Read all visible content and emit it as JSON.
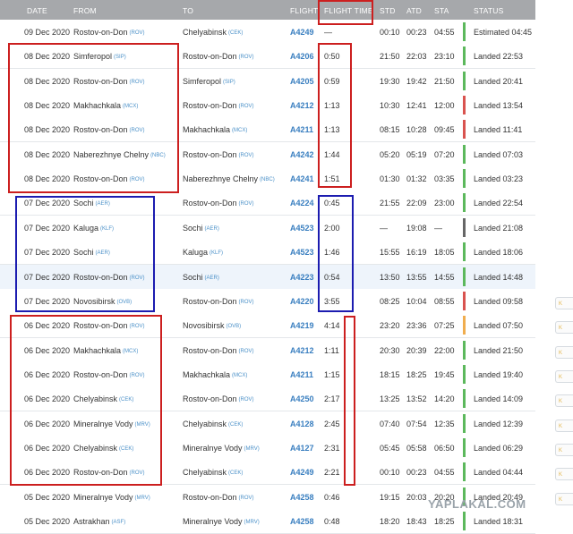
{
  "columns": {
    "date": "DATE",
    "from": "FROM",
    "to": "TO",
    "flight": "FLIGHT",
    "flight_time": "FLIGHT TIME",
    "std": "STD",
    "atd": "ATD",
    "sta": "STA",
    "status": "STATUS"
  },
  "rows": [
    {
      "date": "09 Dec 2020",
      "from": "Rostov-on-Don",
      "from_code": "(ROV)",
      "to": "Chelyabinsk",
      "to_code": "(CEK)",
      "flight": "A4249",
      "flight_time": "—",
      "std": "00:10",
      "atd": "00:23",
      "sta": "04:55",
      "status": "Estimated 04:45",
      "status_color": "#5cb85c"
    },
    {
      "date": "08 Dec 2020",
      "from": "Simferopol",
      "from_code": "(SIP)",
      "to": "Rostov-on-Don",
      "to_code": "(ROV)",
      "flight": "A4206",
      "flight_time": "0:50",
      "std": "21:50",
      "atd": "22:03",
      "sta": "23:10",
      "status": "Landed 22:53",
      "status_color": "#5cb85c"
    },
    {
      "date": "08 Dec 2020",
      "from": "Rostov-on-Don",
      "from_code": "(ROV)",
      "to": "Simferopol",
      "to_code": "(SIP)",
      "flight": "A4205",
      "flight_time": "0:59",
      "std": "19:30",
      "atd": "19:42",
      "sta": "21:50",
      "status": "Landed 20:41",
      "status_color": "#5cb85c"
    },
    {
      "date": "08 Dec 2020",
      "from": "Makhachkala",
      "from_code": "(MCX)",
      "to": "Rostov-on-Don",
      "to_code": "(ROV)",
      "flight": "A4212",
      "flight_time": "1:13",
      "std": "10:30",
      "atd": "12:41",
      "sta": "12:00",
      "status": "Landed 13:54",
      "status_color": "#d9534f"
    },
    {
      "date": "08 Dec 2020",
      "from": "Rostov-on-Don",
      "from_code": "(ROV)",
      "to": "Makhachkala",
      "to_code": "(MCX)",
      "flight": "A4211",
      "flight_time": "1:13",
      "std": "08:15",
      "atd": "10:28",
      "sta": "09:45",
      "status": "Landed 11:41",
      "status_color": "#d9534f"
    },
    {
      "date": "08 Dec 2020",
      "from": "Naberezhnye Chelny",
      "from_code": "(NBC)",
      "to": "Rostov-on-Don",
      "to_code": "(ROV)",
      "flight": "A4242",
      "flight_time": "1:44",
      "std": "05:20",
      "atd": "05:19",
      "sta": "07:20",
      "status": "Landed 07:03",
      "status_color": "#5cb85c"
    },
    {
      "date": "08 Dec 2020",
      "from": "Rostov-on-Don",
      "from_code": "(ROV)",
      "to": "Naberezhnye Chelny",
      "to_code": "(NBC)",
      "flight": "A4241",
      "flight_time": "1:51",
      "std": "01:30",
      "atd": "01:32",
      "sta": "03:35",
      "status": "Landed 03:23",
      "status_color": "#5cb85c"
    },
    {
      "date": "07 Dec 2020",
      "from": "Sochi",
      "from_code": "(AER)",
      "to": "Rostov-on-Don",
      "to_code": "(ROV)",
      "flight": "A4224",
      "flight_time": "0:45",
      "std": "21:55",
      "atd": "22:09",
      "sta": "23:00",
      "status": "Landed 22:54",
      "status_color": "#5cb85c"
    },
    {
      "date": "07 Dec 2020",
      "from": "Kaluga",
      "from_code": "(KLF)",
      "to": "Sochi",
      "to_code": "(AER)",
      "flight": "A4523",
      "flight_time": "2:00",
      "std": "—",
      "atd": "19:08",
      "sta": "—",
      "status": "Landed 21:08",
      "status_color": "#666666"
    },
    {
      "date": "07 Dec 2020",
      "from": "Sochi",
      "from_code": "(AER)",
      "to": "Kaluga",
      "to_code": "(KLF)",
      "flight": "A4523",
      "flight_time": "1:46",
      "std": "15:55",
      "atd": "16:19",
      "sta": "18:05",
      "status": "Landed 18:06",
      "status_color": "#5cb85c"
    },
    {
      "date": "07 Dec 2020",
      "from": "Rostov-on-Don",
      "from_code": "(ROV)",
      "to": "Sochi",
      "to_code": "(AER)",
      "flight": "A4223",
      "flight_time": "0:54",
      "std": "13:50",
      "atd": "13:55",
      "sta": "14:55",
      "status": "Landed 14:48",
      "status_color": "#5cb85c",
      "highlight": true
    },
    {
      "date": "07 Dec 2020",
      "from": "Novosibirsk",
      "from_code": "(OVB)",
      "to": "Rostov-on-Don",
      "to_code": "(ROV)",
      "flight": "A4220",
      "flight_time": "3:55",
      "std": "08:25",
      "atd": "10:04",
      "sta": "08:55",
      "status": "Landed 09:58",
      "status_color": "#d9534f"
    },
    {
      "date": "06 Dec 2020",
      "from": "Rostov-on-Don",
      "from_code": "(ROV)",
      "to": "Novosibirsk",
      "to_code": "(OVB)",
      "flight": "A4219",
      "flight_time": "4:14",
      "std": "23:20",
      "atd": "23:36",
      "sta": "07:25",
      "status": "Landed 07:50",
      "status_color": "#f0ad4e"
    },
    {
      "date": "06 Dec 2020",
      "from": "Makhachkala",
      "from_code": "(MCX)",
      "to": "Rostov-on-Don",
      "to_code": "(ROV)",
      "flight": "A4212",
      "flight_time": "1:11",
      "std": "20:30",
      "atd": "20:39",
      "sta": "22:00",
      "status": "Landed 21:50",
      "status_color": "#5cb85c"
    },
    {
      "date": "06 Dec 2020",
      "from": "Rostov-on-Don",
      "from_code": "(ROV)",
      "to": "Makhachkala",
      "to_code": "(MCX)",
      "flight": "A4211",
      "flight_time": "1:15",
      "std": "18:15",
      "atd": "18:25",
      "sta": "19:45",
      "status": "Landed 19:40",
      "status_color": "#5cb85c"
    },
    {
      "date": "06 Dec 2020",
      "from": "Chelyabinsk",
      "from_code": "(CEK)",
      "to": "Rostov-on-Don",
      "to_code": "(ROV)",
      "flight": "A4250",
      "flight_time": "2:17",
      "std": "13:25",
      "atd": "13:52",
      "sta": "14:20",
      "status": "Landed 14:09",
      "status_color": "#5cb85c"
    },
    {
      "date": "06 Dec 2020",
      "from": "Mineralnye Vody",
      "from_code": "(MRV)",
      "to": "Chelyabinsk",
      "to_code": "(CEK)",
      "flight": "A4128",
      "flight_time": "2:45",
      "std": "07:40",
      "atd": "07:54",
      "sta": "12:35",
      "status": "Landed 12:39",
      "status_color": "#5cb85c"
    },
    {
      "date": "06 Dec 2020",
      "from": "Chelyabinsk",
      "from_code": "(CEK)",
      "to": "Mineralnye Vody",
      "to_code": "(MRV)",
      "flight": "A4127",
      "flight_time": "2:31",
      "std": "05:45",
      "atd": "05:58",
      "sta": "06:50",
      "status": "Landed 06:29",
      "status_color": "#5cb85c"
    },
    {
      "date": "06 Dec 2020",
      "from": "Rostov-on-Don",
      "from_code": "(ROV)",
      "to": "Chelyabinsk",
      "to_code": "(CEK)",
      "flight": "A4249",
      "flight_time": "2:21",
      "std": "00:10",
      "atd": "00:23",
      "sta": "04:55",
      "status": "Landed 04:44",
      "status_color": "#5cb85c"
    },
    {
      "date": "05 Dec 2020",
      "from": "Mineralnye Vody",
      "from_code": "(MRV)",
      "to": "Rostov-on-Don",
      "to_code": "(ROV)",
      "flight": "A4258",
      "flight_time": "0:46",
      "std": "19:15",
      "atd": "20:03",
      "sta": "20:20",
      "status": "Landed 20:49",
      "status_color": "#5cb85c"
    },
    {
      "date": "05 Dec 2020",
      "from": "Astrakhan",
      "from_code": "(ASF)",
      "to": "Mineralnye Vody",
      "to_code": "(MRV)",
      "flight": "A4258",
      "flight_time": "0:48",
      "std": "18:20",
      "atd": "18:43",
      "sta": "18:25",
      "status": "Landed 18:31",
      "status_color": "#5cb85c"
    }
  ],
  "side_tags": [
    "K",
    "K",
    "K",
    "K",
    "K",
    "K",
    "K",
    "K",
    "K"
  ],
  "annotation_colors": {
    "red": "#cc1f1f",
    "blue": "#1c1cb0"
  },
  "watermark": "YAPLAKAL.COM"
}
